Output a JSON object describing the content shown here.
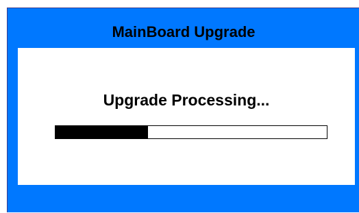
{
  "dialog": {
    "title": "MainBoard Upgrade",
    "status_text": "Upgrade Processing...",
    "progress_fraction": 0.34
  },
  "colors": {
    "frame": "#0078ff",
    "panel": "#ffffff",
    "progress_fill": "#000000",
    "text": "#000000"
  }
}
